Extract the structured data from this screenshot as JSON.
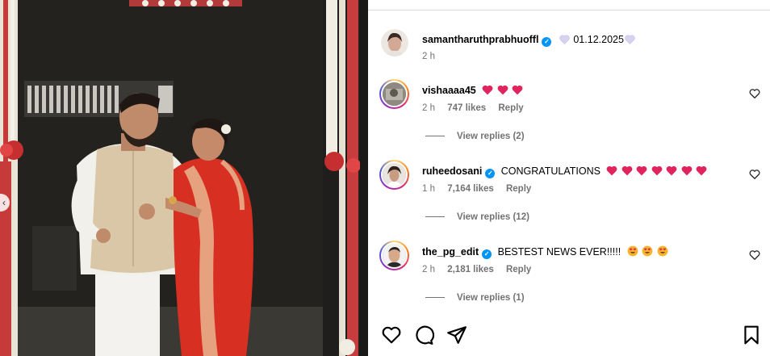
{
  "post": {
    "author": "samantharuthprabhuoffl",
    "caption": "01.12.2025",
    "time": "2 h"
  },
  "comments": [
    {
      "username": "vishaaaa45",
      "verified": false,
      "text": "",
      "emojis": [
        "heart-red",
        "heart-red",
        "heart-red"
      ],
      "time": "2 h",
      "likes": "747 likes",
      "reply_label": "Reply",
      "view_replies": "View replies (2)"
    },
    {
      "username": "ruheedosani",
      "verified": true,
      "text": "CONGRATULATIONS",
      "emojis": [
        "heart-pink",
        "heart-pink",
        "heart-pink",
        "heart-pink",
        "heart-pink",
        "heart-pink",
        "heart-pink"
      ],
      "time": "1 h",
      "likes": "7,164 likes",
      "reply_label": "Reply",
      "view_replies": "View replies (12)"
    },
    {
      "username": "the_pg_edit",
      "verified": true,
      "text": "BESTEST NEWS EVER!!!!!",
      "emojis": [
        "heart-eyes",
        "heart-eyes",
        "heart-eyes"
      ],
      "time": "2 h",
      "likes": "2,181 likes",
      "reply_label": "Reply",
      "view_replies": "View replies (1)"
    }
  ],
  "icons": {
    "like": "heart-outline-icon",
    "comment": "comment-bubble-icon",
    "share": "paper-plane-icon",
    "save": "bookmark-icon",
    "verified": "verified-badge-icon",
    "carousel_prev": "chevron-left-icon"
  },
  "colors": {
    "verified_blue": "#0095f6",
    "meta_gray": "#737373",
    "heart_red": "#e0245e",
    "lavender_heart": "#d8d2f0"
  }
}
